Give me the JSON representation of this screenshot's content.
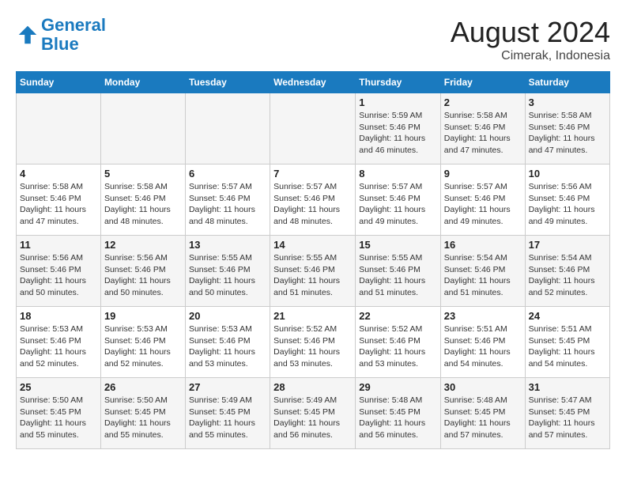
{
  "header": {
    "logo_line1": "General",
    "logo_line2": "Blue",
    "month_year": "August 2024",
    "location": "Cimerak, Indonesia"
  },
  "days_of_week": [
    "Sunday",
    "Monday",
    "Tuesday",
    "Wednesday",
    "Thursday",
    "Friday",
    "Saturday"
  ],
  "weeks": [
    [
      {
        "day": "",
        "info": ""
      },
      {
        "day": "",
        "info": ""
      },
      {
        "day": "",
        "info": ""
      },
      {
        "day": "",
        "info": ""
      },
      {
        "day": "1",
        "info": "Sunrise: 5:59 AM\nSunset: 5:46 PM\nDaylight: 11 hours\nand 46 minutes."
      },
      {
        "day": "2",
        "info": "Sunrise: 5:58 AM\nSunset: 5:46 PM\nDaylight: 11 hours\nand 47 minutes."
      },
      {
        "day": "3",
        "info": "Sunrise: 5:58 AM\nSunset: 5:46 PM\nDaylight: 11 hours\nand 47 minutes."
      }
    ],
    [
      {
        "day": "4",
        "info": "Sunrise: 5:58 AM\nSunset: 5:46 PM\nDaylight: 11 hours\nand 47 minutes."
      },
      {
        "day": "5",
        "info": "Sunrise: 5:58 AM\nSunset: 5:46 PM\nDaylight: 11 hours\nand 48 minutes."
      },
      {
        "day": "6",
        "info": "Sunrise: 5:57 AM\nSunset: 5:46 PM\nDaylight: 11 hours\nand 48 minutes."
      },
      {
        "day": "7",
        "info": "Sunrise: 5:57 AM\nSunset: 5:46 PM\nDaylight: 11 hours\nand 48 minutes."
      },
      {
        "day": "8",
        "info": "Sunrise: 5:57 AM\nSunset: 5:46 PM\nDaylight: 11 hours\nand 49 minutes."
      },
      {
        "day": "9",
        "info": "Sunrise: 5:57 AM\nSunset: 5:46 PM\nDaylight: 11 hours\nand 49 minutes."
      },
      {
        "day": "10",
        "info": "Sunrise: 5:56 AM\nSunset: 5:46 PM\nDaylight: 11 hours\nand 49 minutes."
      }
    ],
    [
      {
        "day": "11",
        "info": "Sunrise: 5:56 AM\nSunset: 5:46 PM\nDaylight: 11 hours\nand 50 minutes."
      },
      {
        "day": "12",
        "info": "Sunrise: 5:56 AM\nSunset: 5:46 PM\nDaylight: 11 hours\nand 50 minutes."
      },
      {
        "day": "13",
        "info": "Sunrise: 5:55 AM\nSunset: 5:46 PM\nDaylight: 11 hours\nand 50 minutes."
      },
      {
        "day": "14",
        "info": "Sunrise: 5:55 AM\nSunset: 5:46 PM\nDaylight: 11 hours\nand 51 minutes."
      },
      {
        "day": "15",
        "info": "Sunrise: 5:55 AM\nSunset: 5:46 PM\nDaylight: 11 hours\nand 51 minutes."
      },
      {
        "day": "16",
        "info": "Sunrise: 5:54 AM\nSunset: 5:46 PM\nDaylight: 11 hours\nand 51 minutes."
      },
      {
        "day": "17",
        "info": "Sunrise: 5:54 AM\nSunset: 5:46 PM\nDaylight: 11 hours\nand 52 minutes."
      }
    ],
    [
      {
        "day": "18",
        "info": "Sunrise: 5:53 AM\nSunset: 5:46 PM\nDaylight: 11 hours\nand 52 minutes."
      },
      {
        "day": "19",
        "info": "Sunrise: 5:53 AM\nSunset: 5:46 PM\nDaylight: 11 hours\nand 52 minutes."
      },
      {
        "day": "20",
        "info": "Sunrise: 5:53 AM\nSunset: 5:46 PM\nDaylight: 11 hours\nand 53 minutes."
      },
      {
        "day": "21",
        "info": "Sunrise: 5:52 AM\nSunset: 5:46 PM\nDaylight: 11 hours\nand 53 minutes."
      },
      {
        "day": "22",
        "info": "Sunrise: 5:52 AM\nSunset: 5:46 PM\nDaylight: 11 hours\nand 53 minutes."
      },
      {
        "day": "23",
        "info": "Sunrise: 5:51 AM\nSunset: 5:46 PM\nDaylight: 11 hours\nand 54 minutes."
      },
      {
        "day": "24",
        "info": "Sunrise: 5:51 AM\nSunset: 5:45 PM\nDaylight: 11 hours\nand 54 minutes."
      }
    ],
    [
      {
        "day": "25",
        "info": "Sunrise: 5:50 AM\nSunset: 5:45 PM\nDaylight: 11 hours\nand 55 minutes."
      },
      {
        "day": "26",
        "info": "Sunrise: 5:50 AM\nSunset: 5:45 PM\nDaylight: 11 hours\nand 55 minutes."
      },
      {
        "day": "27",
        "info": "Sunrise: 5:49 AM\nSunset: 5:45 PM\nDaylight: 11 hours\nand 55 minutes."
      },
      {
        "day": "28",
        "info": "Sunrise: 5:49 AM\nSunset: 5:45 PM\nDaylight: 11 hours\nand 56 minutes."
      },
      {
        "day": "29",
        "info": "Sunrise: 5:48 AM\nSunset: 5:45 PM\nDaylight: 11 hours\nand 56 minutes."
      },
      {
        "day": "30",
        "info": "Sunrise: 5:48 AM\nSunset: 5:45 PM\nDaylight: 11 hours\nand 57 minutes."
      },
      {
        "day": "31",
        "info": "Sunrise: 5:47 AM\nSunset: 5:45 PM\nDaylight: 11 hours\nand 57 minutes."
      }
    ]
  ]
}
